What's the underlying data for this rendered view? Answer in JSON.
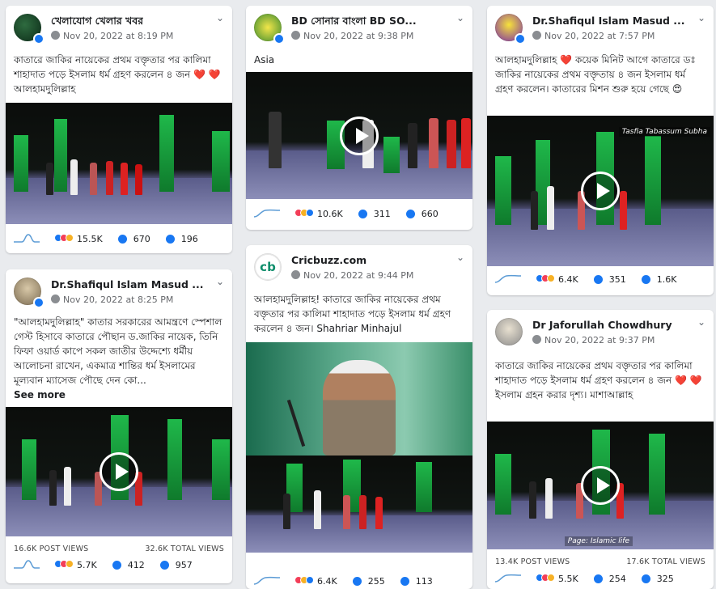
{
  "posts": [
    {
      "name": "খেলাযোগ খেলার খবর",
      "time": "Nov 20, 2022 at 8:19 PM",
      "text": "কাতারে জাকির নায়েকের প্রথম বক্তৃতার পর কালিমা শাহাদাত পড়ে ইসলাম ধর্ম গ্রহণ করলেন ৪ জন ❤️ ❤️ আলহামদুলিল্লাহ",
      "reactions": "15.5K",
      "comments": "670",
      "shares": "196"
    },
    {
      "name": "Dr.Shafiqul Islam Masud ...",
      "time": "Nov 20, 2022 at 8:25 PM",
      "text": "\"আলহামদুলিল্লাহ\" কাতার সরকারের আমন্ত্রণে স্পেশাল গেস্ট হিসাবে কাতারে পৌছান ড.জাকির নায়েক, তিনি ফিফা ওয়ার্ড কাপে সকল জাতীর উদ্দেশ্যে ধর্মীয় আলোচনা রাখেন, একমাত্র শান্তির ধর্ম ইসলামের মূল্যবান ম্যাসেজ পৌছে দেন কো...",
      "see_more": "See more",
      "post_views": "16.6K POST VIEWS",
      "total_views": "32.6K TOTAL VIEWS",
      "reactions": "5.7K",
      "comments": "412",
      "shares": "957"
    },
    {
      "name": "BD সোনার বাংলা BD SO...",
      "time": "Nov 20, 2022 at 9:38 PM",
      "text": "Asia",
      "reactions": "10.6K",
      "comments": "311",
      "shares": "660"
    },
    {
      "name": "Cricbuzz.com",
      "time": "Nov 20, 2022 at 9:44 PM",
      "text": "আলহামদুলিল্লাহ! কাতারে জাকির নায়েকের প্রথম বক্তৃতার পর কালিমা শাহাদাত পড়ে ইসলাম ধর্ম গ্রহণ করলেন ৪ জন। Shahriar Minhajul",
      "reactions": "6.4K",
      "comments": "255",
      "shares": "113"
    },
    {
      "name": "Dr.Shafiqul Islam Masud ...",
      "time": "Nov 20, 2022 at 7:57 PM",
      "text": "আলহামদুলিল্লাহ ❤️ কয়েক মিনিট আগে কাতারে ডঃ জাকির নায়েকের প্রথম বক্তৃতায় ৪ জন ইসলাম ধর্ম গ্রহণ করলেন। কাতারের মিশন শুরু হয়ে গেছে 😍",
      "watermark": "Tasfia Tabassum Subha",
      "reactions": "6.4K",
      "comments": "351",
      "shares": "1.6K"
    },
    {
      "name": "Dr Jaforullah Chowdhury",
      "time": "Nov 20, 2022 at 9:37 PM",
      "text": "কাতারে জাকির নায়েকের প্রথম বক্তৃতার পর কালিমা শাহাদাত পড়ে ইসলাম ধর্ম গ্রহণ করলেন ৪ জন ❤️ ❤️ ইসলাম গ্রহন করার দৃশ্য। মাশাআল্লাহ",
      "watermark": "Page: Islamic life",
      "post_views": "13.4K POST VIEWS",
      "total_views": "17.6K TOTAL VIEWS",
      "reactions": "5.5K",
      "comments": "254",
      "shares": "325"
    }
  ],
  "colors": {
    "accent": "#1877f2",
    "love": "#f33e58",
    "haha": "#f7b125",
    "comment": "#1877f2",
    "spark": "#5b9bd5",
    "stage_green": "#1fb84a"
  },
  "icons": {
    "menu": "chevron-down-icon",
    "comment": "comment-icon",
    "share": "share-icon",
    "play": "play-icon",
    "globe": "globe-icon"
  }
}
